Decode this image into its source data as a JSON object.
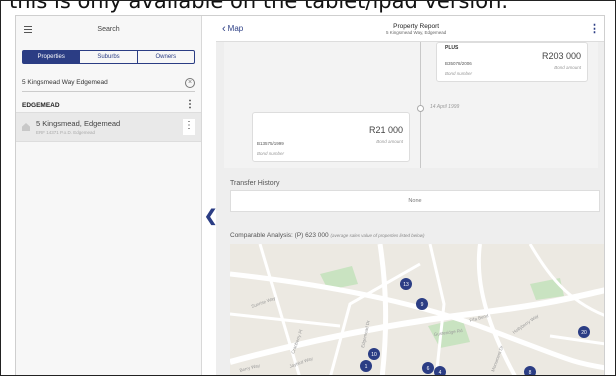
{
  "caption": "this is only available on the tablet/ipad version.",
  "left_panel": {
    "title": "Search",
    "tabs": [
      {
        "label": "Properties",
        "active": true
      },
      {
        "label": "Suburbs",
        "active": false
      },
      {
        "label": "Owners",
        "active": false
      }
    ],
    "search_value": "5 Kingsmead Way Edgemead",
    "group_header": "EDGEMEAD",
    "result": {
      "title": "5 Kingsmead, Edgemead",
      "subtitle": "ERF 14371 P.o.D. Edgemead"
    }
  },
  "top_bar": {
    "back_label": "Map",
    "title": "Property Report",
    "subtitle": "5 Kingsmead Way, Edgemead"
  },
  "timeline": {
    "card_top_right": {
      "label": "PLUS",
      "id": "B35078/2006",
      "amount": "R203 000",
      "amount_label": "Bond amount",
      "number_label": "Bond number"
    },
    "card_left": {
      "id": "B13575/1999",
      "amount": "R21 000",
      "amount_label": "Bond amount",
      "number_label": "Bond number"
    },
    "node_date": "14 April 1999"
  },
  "transfer": {
    "label": "Transfer History",
    "value": "None"
  },
  "analysis": {
    "label": "Comparable Analysis: (P) 623 000",
    "note": "(average sales value of properties listed below)"
  },
  "map": {
    "streets": [
      "Sunrise Way",
      "Cranberry Pl",
      "Fifa Bend",
      "Gusteridge Rd",
      "Edgemead Dr",
      "Hollyberry Way",
      "Berry Way",
      "Monument Dr",
      "Jaybird Way"
    ],
    "pins": [
      "13",
      "1",
      "10",
      "9",
      "6",
      "4",
      "20",
      "8"
    ]
  },
  "colors": {
    "accent": "#2b3d84",
    "panel_bg": "#f7f7f7",
    "map_bg": "#ece9e2",
    "park": "#c9e3c1"
  }
}
